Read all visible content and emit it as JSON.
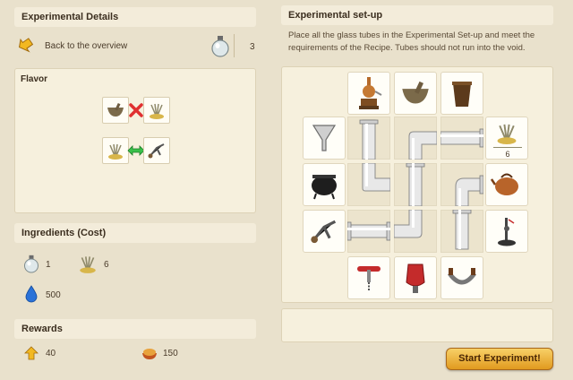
{
  "left": {
    "title": "Experimental Details",
    "back_label": "Back to the overview",
    "flask_count": "3",
    "flavor_title": "Flavor",
    "ingredients_title": "Ingredients (Cost)",
    "ingredients": [
      {
        "icon": "flask-icon",
        "value": "1"
      },
      {
        "icon": "herbs-icon",
        "value": "6"
      },
      {
        "icon": "water-drop-icon",
        "value": "500"
      }
    ],
    "rewards_title": "Rewards",
    "rewards": [
      {
        "icon": "up-arrow-icon",
        "value": "40"
      },
      {
        "icon": "food-bowl-icon",
        "value": "150"
      }
    ]
  },
  "right": {
    "title": "Experimental set-up",
    "instructions": "Place all the glass tubes in the Experimental Set-up and meet the requirements of the Recipe. Tubes should not run into the void.",
    "herbs_count": "6",
    "start_button": "Start Experiment!"
  },
  "tools": {
    "top": [
      "distiller-icon",
      "mortar-icon",
      "bucket-icon"
    ],
    "left": [
      "funnel-icon",
      "cauldron-icon",
      "tongs-icon"
    ],
    "right": [
      "herbs-icon",
      "kettle-icon",
      "stand-icon"
    ],
    "bottom": [
      "corkscrew-icon",
      "bellows-icon",
      "mezzaluna-icon"
    ]
  },
  "colors": {
    "background": "#e9e1cc",
    "panel": "#f6f0dd",
    "button": "#f0b33c",
    "cross": "#e03030",
    "arrow": "#39c04a"
  }
}
